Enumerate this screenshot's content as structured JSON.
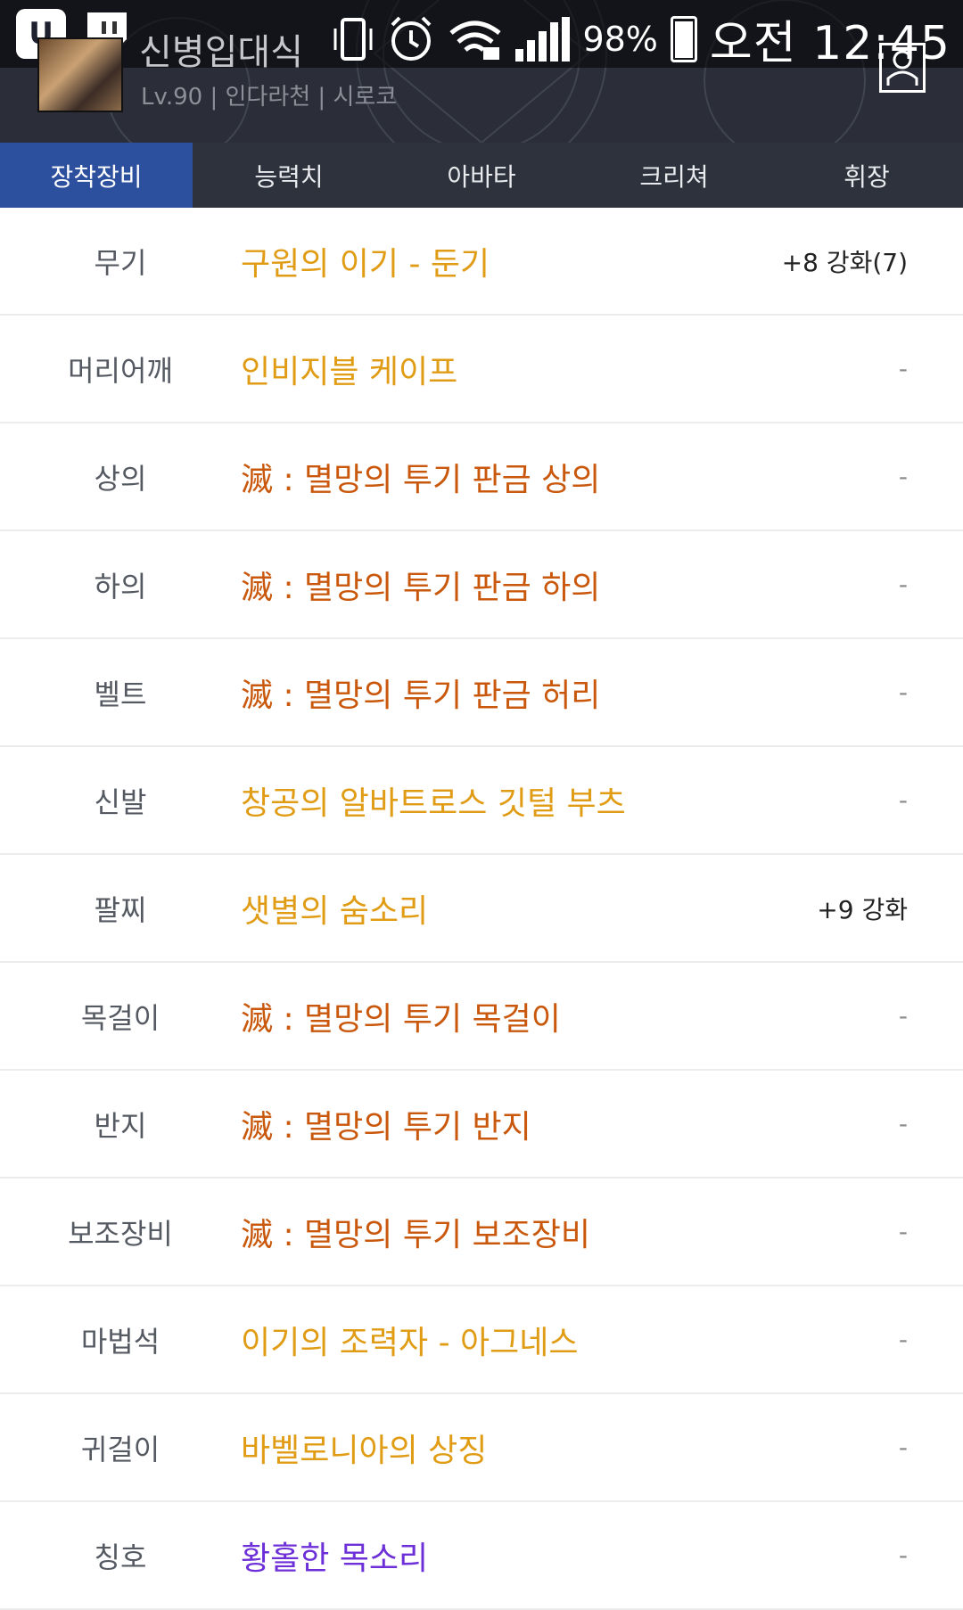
{
  "status_bar": {
    "left_icons": [
      "u-plus-app-icon",
      "twitch-icon"
    ],
    "battery_percent": "98%",
    "clock": "오전 12:45"
  },
  "profile": {
    "name": "신병입대식",
    "subtitle": "Lv.90 | 인다라천 | 시로코"
  },
  "tabs": [
    {
      "label": "장착장비",
      "active": true
    },
    {
      "label": "능력치",
      "active": false
    },
    {
      "label": "아바타",
      "active": false
    },
    {
      "label": "크리쳐",
      "active": false
    },
    {
      "label": "휘장",
      "active": false
    }
  ],
  "equipment": [
    {
      "slot": "무기",
      "item": "구원의 이기 - 둔기",
      "extra": "+8 강화(7)",
      "rarity": "legendary"
    },
    {
      "slot": "머리어깨",
      "item": "인비지블 케이프",
      "extra": "-",
      "rarity": "legendary"
    },
    {
      "slot": "상의",
      "item": "滅 : 멸망의 투기 판금 상의",
      "extra": "-",
      "rarity": "epic"
    },
    {
      "slot": "하의",
      "item": "滅 : 멸망의 투기 판금 하의",
      "extra": "-",
      "rarity": "epic"
    },
    {
      "slot": "벨트",
      "item": "滅 : 멸망의 투기 판금 허리",
      "extra": "-",
      "rarity": "epic"
    },
    {
      "slot": "신발",
      "item": "창공의 알바트로스 깃털 부츠",
      "extra": "-",
      "rarity": "legendary"
    },
    {
      "slot": "팔찌",
      "item": "샛별의 숨소리",
      "extra": "+9 강화",
      "rarity": "legendary"
    },
    {
      "slot": "목걸이",
      "item": "滅 : 멸망의 투기 목걸이",
      "extra": "-",
      "rarity": "epic"
    },
    {
      "slot": "반지",
      "item": "滅 : 멸망의 투기 반지",
      "extra": "-",
      "rarity": "epic"
    },
    {
      "slot": "보조장비",
      "item": "滅 : 멸망의 투기 보조장비",
      "extra": "-",
      "rarity": "epic"
    },
    {
      "slot": "마법석",
      "item": "이기의 조력자 - 아그네스",
      "extra": "-",
      "rarity": "legendary"
    },
    {
      "slot": "귀걸이",
      "item": "바벨로니아의 상징",
      "extra": "-",
      "rarity": "legendary"
    },
    {
      "slot": "칭호",
      "item": "황홀한 목소리",
      "extra": "-",
      "rarity": "unique"
    }
  ],
  "colors": {
    "legendary": "#e09c14",
    "epic": "#c9580c",
    "unique": "#6c2fd8",
    "active_tab": "#2d509e",
    "tab_bar": "#2d323c"
  }
}
